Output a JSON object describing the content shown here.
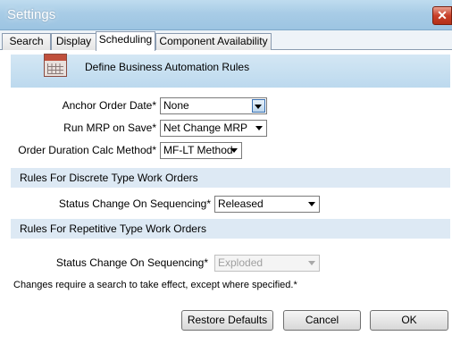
{
  "window": {
    "title": "Settings",
    "close_label": "✕"
  },
  "tabs": [
    {
      "label": "Search"
    },
    {
      "label": "Display"
    },
    {
      "label": "Scheduling"
    },
    {
      "label": "Component Availability"
    }
  ],
  "header": {
    "icon": "calendar-icon",
    "title": "Define Business Automation Rules"
  },
  "fields": {
    "anchor_order_date": {
      "label": "Anchor Order Date*",
      "value": "None"
    },
    "run_mrp_on_save": {
      "label": "Run MRP on Save*",
      "value": "Net Change MRP"
    },
    "order_duration_calc": {
      "label": "Order Duration Calc Method*",
      "value": "MF-LT Method"
    }
  },
  "discrete": {
    "section_title": "Rules For Discrete Type Work Orders",
    "status_label": "Status Change On Sequencing*",
    "status_value": "Released"
  },
  "repetitive": {
    "section_title": "Rules For Repetitive Type Work Orders",
    "status_label": "Status Change On Sequencing*",
    "status_value": "Exploded"
  },
  "note": "Changes require a search to take effect, except where specified.*",
  "buttons": {
    "restore_defaults": "Restore Defaults",
    "cancel": "Cancel",
    "ok": "OK"
  },
  "colors": {
    "title_bar": "#a8cce6",
    "header_band": "#c8e0f2",
    "section_band": "#dde9f4",
    "close_button": "#c8402a"
  }
}
